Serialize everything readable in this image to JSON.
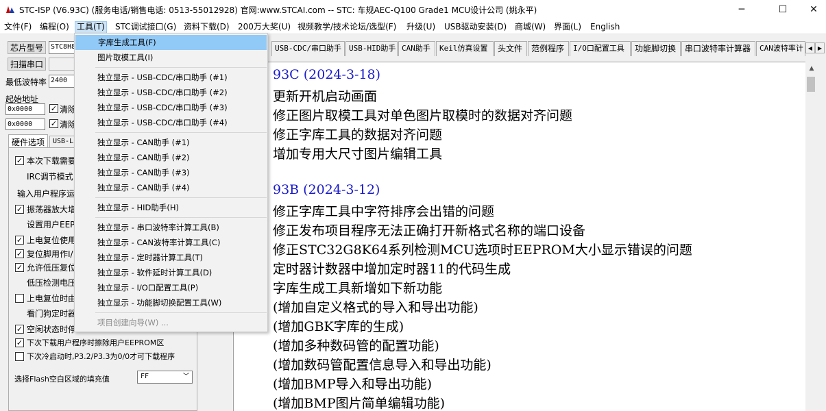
{
  "window": {
    "title": "STC-ISP (V6.93C) (服务电话/销售电话: 0513-55012928) 官网:www.STCAI.com  -- STC: 车规AEC-Q100 Grade1 MCU设计公司 (姚永平)",
    "minimize_glyph": "─",
    "maximize_glyph": "☐",
    "close_glyph": "✕"
  },
  "menubar": [
    "文件(F)",
    "编程(O)",
    "工具(T)",
    "STC调试接口(G)",
    "资料下载(D)",
    "200万大奖(U)",
    "视频教学/技术论坛/选型(F)",
    "升级(U)",
    "USB驱动安装(D)",
    "商城(W)",
    "界面(L)",
    "English"
  ],
  "left": {
    "chip_type_button": "芯片型号",
    "chip_type_value": "STC8H8",
    "scan_port_button": "扫描串口",
    "min_baud_label": "最低波特率",
    "min_baud_value": "2400",
    "start_addr_label": "起始地址",
    "addr1": "0x0000",
    "clear1_label": "清除",
    "addr2": "0x0000",
    "clear2_label": "清除",
    "tab_hw": "硬件选项",
    "tab_usb": "USB-L",
    "options": [
      "本次下载需要",
      "IRC调节模式",
      "输入用户程序运",
      "振荡器放大增",
      "设置用户EEP",
      "上电复位使用",
      "复位脚用作I/",
      "允许低压复位",
      "低压检测电压",
      "上电复位时由",
      "看门狗定时器",
      "空闲状态时停",
      "下次下载用户程序时擦除用户EEPROM区",
      "下次冷启动时,P3.2/P3.3为0/0才可下载程序"
    ],
    "fill_label": "选择Flash空白区域的填充值",
    "fill_value": "FF"
  },
  "tabs": [
    "USB-CDC/串口助手",
    "USB-HID助手",
    "CAN助手",
    "Keil仿真设置",
    "头文件",
    "范例程序",
    "I/O口配置工具",
    "功能脚切换",
    "串口波特率计算器",
    "CAN波特率计"
  ],
  "content_lines": [
    "93C (2024-3-18)",
    "更新开机启动画面",
    "修正图片取模工具对单色图片取模时的数据对齐问题",
    "修正字库工具的数据对齐问题",
    "增加专用大尺寸图片编辑工具",
    "",
    "93B (2024-3-12)",
    "修正字库工具中字符排序会出错的问题",
    "修正发布项目程序无法正确打开新格式名称的端口设备",
    "修正STC32G8K64系列检测MCU选项时EEPROM大小显示错误的问题",
    "定时器计数器中增加定时器11的代码生成",
    "字库生成工具新增如下新功能",
    "(增加自定义格式的导入和导出功能)",
    "(增加GBK字库的生成)",
    "(增加多种数码管的配置功能)",
    "(增加数码管配置信息导入和导出功能)",
    "(增加BMP导入和导出功能)",
    "(增加BMP图片简单编辑功能)"
  ],
  "tools_menu": [
    "字库生成工具(F)",
    "图片取模工具(I)",
    "独立显示 - USB-CDC/串口助手 (#1)",
    "独立显示 - USB-CDC/串口助手 (#2)",
    "独立显示 - USB-CDC/串口助手 (#3)",
    "独立显示 - USB-CDC/串口助手 (#4)",
    "独立显示 - CAN助手 (#1)",
    "独立显示 - CAN助手 (#2)",
    "独立显示 - CAN助手 (#3)",
    "独立显示 - CAN助手 (#4)",
    "独立显示 - HID助手(H)",
    "独立显示 - 串口波特率计算工具(B)",
    "独立显示 - CAN波特率计算工具(C)",
    "独立显示 - 定时器计算工具(T)",
    "独立显示 - 软件延时计算工具(D)",
    "独立显示 - I/O口配置工具(P)",
    "独立显示 - 功能脚切换配置工具(W)",
    "项目创建向导(W) ..."
  ],
  "colors": {
    "highlight": "#91c9f7",
    "version_text": "#1a1acc",
    "disabled_text": "#8c8c8c"
  }
}
